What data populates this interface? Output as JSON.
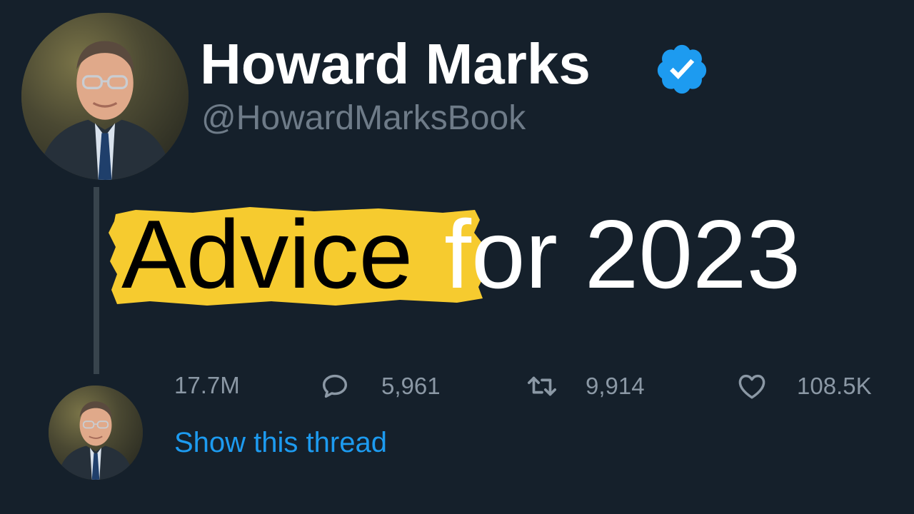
{
  "profile": {
    "display_name": "Howard Marks",
    "handle": "@HowardMarksBook",
    "verified_icon": "verified-badge-icon",
    "verified_color": "#1d9bf0",
    "avatar": "avatar-photo"
  },
  "tweet": {
    "highlighted_word": "Advice",
    "rest_text": "for 2023",
    "highlight_color": "#f6cb2f"
  },
  "stats": {
    "views": "17.7M",
    "replies": "5,961",
    "retweets": "9,914",
    "likes": "108.5K",
    "icons": [
      "reply-icon",
      "retweet-icon",
      "like-icon"
    ]
  },
  "thread": {
    "show_label": "Show this thread",
    "link_color": "#1d9bf0"
  },
  "colors": {
    "background": "#15202b",
    "muted_text": "#8b98a5",
    "thread_line": "#38444d"
  }
}
